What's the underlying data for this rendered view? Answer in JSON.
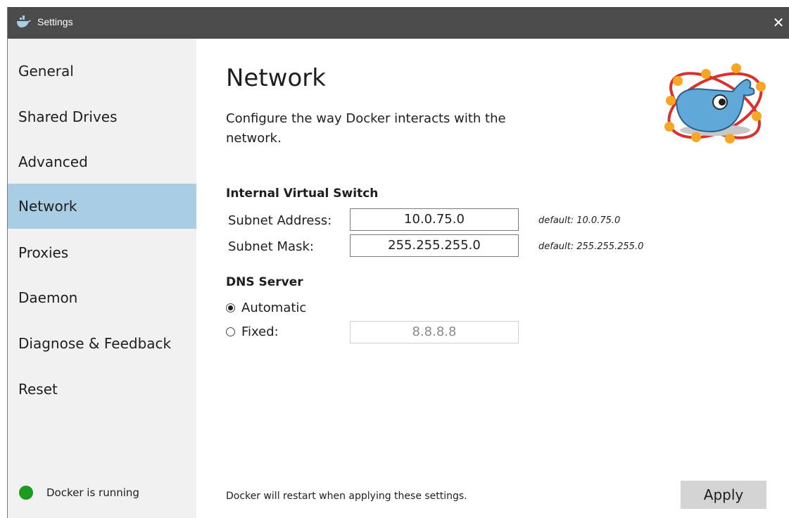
{
  "window": {
    "title": "Settings",
    "close_glyph": "✕",
    "app_icon": "docker-whale-icon"
  },
  "sidebar": {
    "items": [
      {
        "label": "General",
        "active": false
      },
      {
        "label": "Shared Drives",
        "active": false
      },
      {
        "label": "Advanced",
        "active": false
      },
      {
        "label": "Network",
        "active": true
      },
      {
        "label": "Proxies",
        "active": false
      },
      {
        "label": "Daemon",
        "active": false
      },
      {
        "label": "Diagnose & Feedback",
        "active": false
      },
      {
        "label": "Reset",
        "active": false
      }
    ],
    "status": {
      "text": "Docker is running",
      "color": "#1e9a1e"
    }
  },
  "main": {
    "title": "Network",
    "description": "Configure the way Docker interacts with the network.",
    "switch_section": {
      "heading": "Internal Virtual Switch",
      "subnet_address": {
        "label": "Subnet Address:",
        "value": "10.0.75.0",
        "hint": "default: 10.0.75.0"
      },
      "subnet_mask": {
        "label": "Subnet Mask:",
        "value": "255.255.255.0",
        "hint": "default: 255.255.255.0"
      }
    },
    "dns_section": {
      "heading": "DNS Server",
      "automatic": {
        "label": "Automatic",
        "checked": true
      },
      "fixed": {
        "label": "Fixed:",
        "checked": false,
        "value": "8.8.8.8"
      }
    },
    "footer_note": "Docker will restart when applying these settings.",
    "apply_label": "Apply"
  },
  "colors": {
    "titlebar": "#4b4b4b",
    "sidebar_bg": "#f1f1f1",
    "active_item": "#a9cde3",
    "apply_bg": "#d4d4d4"
  }
}
